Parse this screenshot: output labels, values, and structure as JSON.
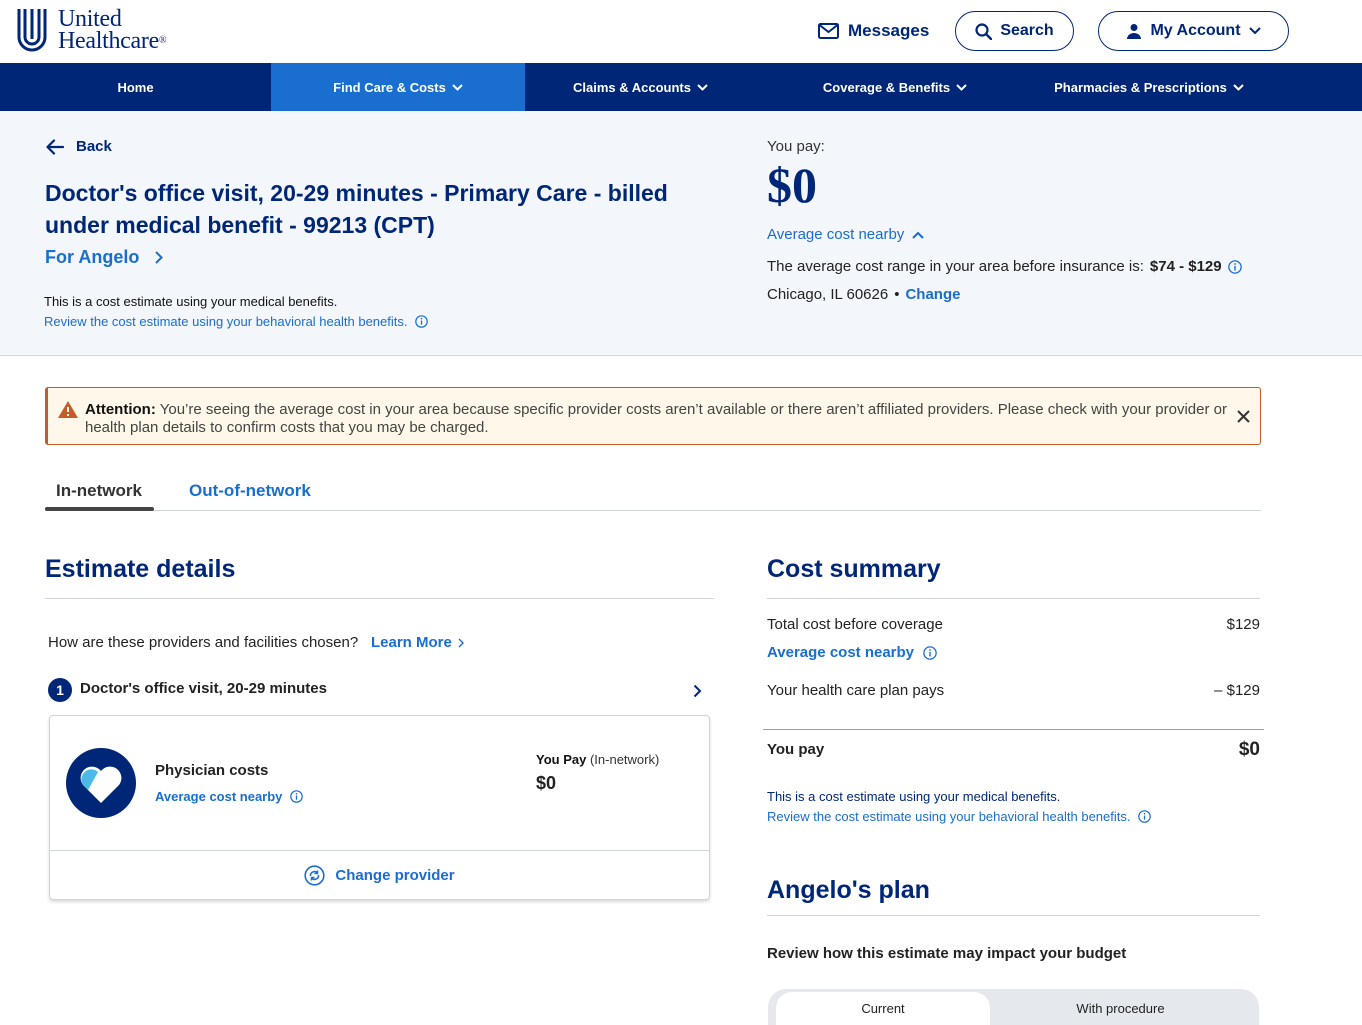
{
  "brand": {
    "line1": "United",
    "line2": "Healthcare",
    "reg": "®",
    "color": "#002677",
    "accent": "#196ECF"
  },
  "header": {
    "messages_label": "Messages",
    "search_label": "Search",
    "account_label": "My Account"
  },
  "nav": {
    "items": [
      {
        "label": "Home"
      },
      {
        "label": "Find Care & Costs"
      },
      {
        "label": "Claims & Accounts"
      },
      {
        "label": "Coverage & Benefits"
      },
      {
        "label": "Pharmacies & Prescriptions"
      }
    ],
    "active_index": 1
  },
  "hero": {
    "back_label": "Back",
    "title": "Doctor's office visit, 20-29 minutes - Primary Care - billed under medical benefit - 99213 (CPT)",
    "for_label": "For Angelo",
    "estimate_note": "This is a cost estimate using your medical benefits.",
    "behavioral_link": "Review the cost estimate using your behavioral health benefits.",
    "you_pay_label": "You pay:",
    "you_pay_amount": "$0",
    "avg_cost_link": "Average cost nearby",
    "range_text": "The average cost range in your area before insurance is:",
    "range_value": "$74 - $129",
    "location": "Chicago, IL 60626",
    "bullet": "•",
    "change_link": "Change"
  },
  "attention": {
    "label": "Attention:",
    "text": "You’re seeing the average cost in your area because specific provider costs aren’t available or there aren’t affiliated providers. Please check with your provider or health plan details to confirm costs that you may be charged."
  },
  "tabs": [
    {
      "label": "In-network"
    },
    {
      "label": "Out-of-network"
    }
  ],
  "estimate": {
    "heading": "Estimate details",
    "question": "How are these providers and facilities chosen?",
    "learn_more": "Learn More",
    "step_number": "1",
    "step_title": "Doctor's office visit, 20-29 minutes",
    "card_title": "Physician costs",
    "card_avg_link": "Average cost nearby",
    "you_pay_label": "You Pay",
    "you_pay_qualifier": "(In-network)",
    "you_pay_amount": "$0",
    "change_provider": "Change provider"
  },
  "summary": {
    "heading": "Cost summary",
    "total_label": "Total cost before coverage",
    "total_value": "$129",
    "avg_link": "Average cost nearby",
    "plan_pays_label": "Your health care plan pays",
    "plan_pays_value": "– $129",
    "you_pay_label": "You pay",
    "you_pay_value": "$0",
    "note": "This is a cost estimate using your medical benefits.",
    "behavioral_link": "Review the cost estimate using your behavioral health benefits."
  },
  "plan": {
    "heading": "Angelo's plan",
    "subheading": "Review how this estimate may impact your budget",
    "toggle": [
      {
        "label": "Current"
      },
      {
        "label": "With procedure"
      }
    ]
  }
}
